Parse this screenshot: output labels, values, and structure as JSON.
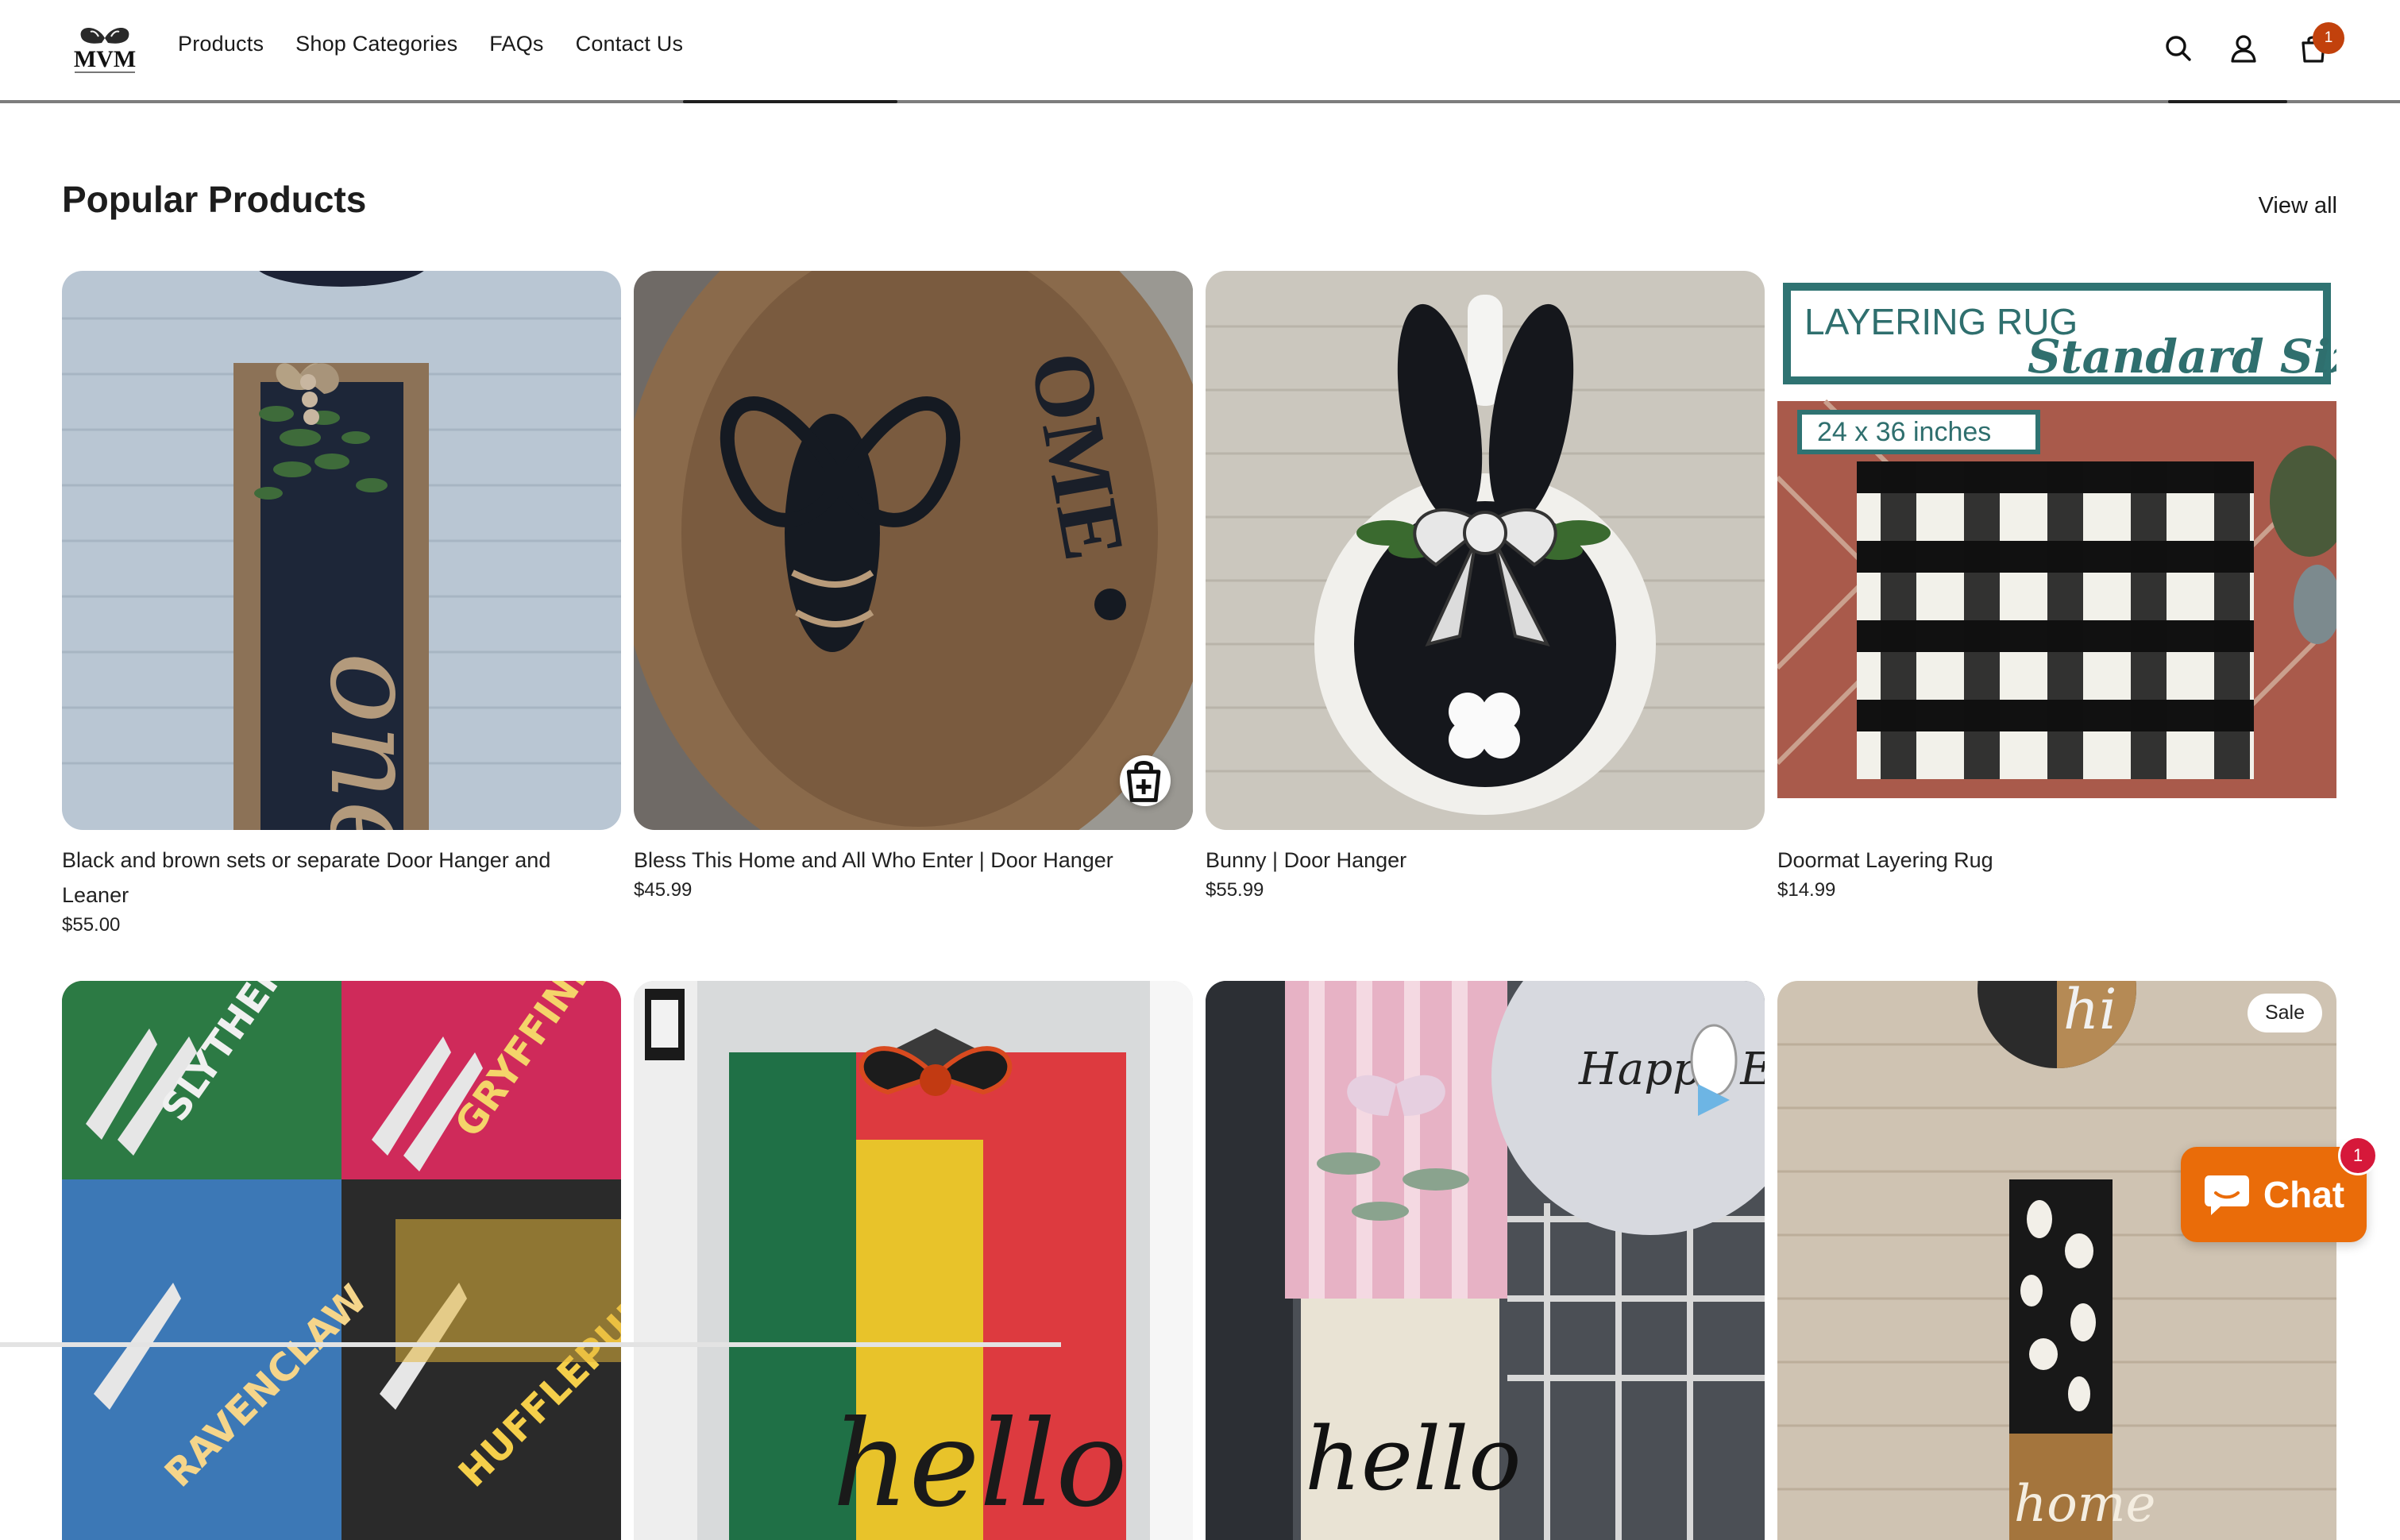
{
  "header": {
    "logo_text": "MVM",
    "nav": [
      "Products",
      "Shop Categories",
      "FAQs",
      "Contact Us"
    ],
    "cart_count": "1"
  },
  "section": {
    "title": "Popular Products",
    "view_all": "View all"
  },
  "products": [
    {
      "title": "Black and brown sets or separate Door Hanger and Leaner",
      "price": "$55.00",
      "image": "one-door-leaner",
      "image_text": "one"
    },
    {
      "title": "Bless This Home and All Who Enter | Door Hanger",
      "price": "$45.99",
      "image": "bee-round-sign",
      "image_text": "OME"
    },
    {
      "title": "Bunny | Door Hanger",
      "price": "$55.99",
      "image": "bunny-hanger"
    },
    {
      "title": "Doormat Layering Rug",
      "price": "$14.99",
      "image": "plaid-rug",
      "banner_line1": "LAYERING RUG",
      "banner_line2": "Standard Size",
      "size_text": "24 x 36 inches"
    },
    {
      "image": "house-claw-signs",
      "labels": [
        "SLYTHERIN",
        "GRYFFINDOR",
        "RAVENCLAW",
        "HUFFLEPUFF"
      ]
    },
    {
      "image": "colorblock-hello-sign",
      "image_text": "hello"
    },
    {
      "image": "hello-easter-signs",
      "image_text": "hello",
      "image_text2": "Happy Easter"
    },
    {
      "image": "home-leaner",
      "badge": "Sale",
      "image_text": "home",
      "image_text2": "hi"
    }
  ],
  "chat": {
    "label": "Chat",
    "count": "1"
  },
  "colors": {
    "accent": "#ea6c09",
    "cart_badge": "#c2410c",
    "chat_badge": "#d6183a"
  }
}
